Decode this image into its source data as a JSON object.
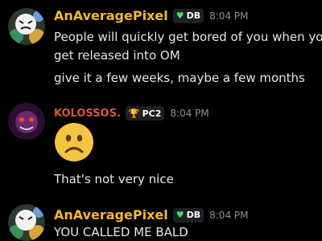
{
  "messages": [
    {
      "author": "AnAveragePixel",
      "author_color": "#f7b731",
      "badge": {
        "icon": "heart-icon",
        "text": "DB",
        "icon_color": "#3ee56a"
      },
      "time": "8:04 PM",
      "lines": [
        "People will quickly get bored of you when you",
        "get released into OM",
        "give it a few weeks, maybe a few months"
      ]
    },
    {
      "author": "KOLOSSOS.",
      "author_color": "#d45a3a",
      "badge": {
        "icon": "trophy-icon",
        "text": "PC2",
        "icon_color": "#f0c23b"
      },
      "time": "8:04 PM",
      "emoji": "frowning-face-emoji",
      "lines": [
        "That's not very nice"
      ]
    },
    {
      "author": "AnAveragePixel",
      "author_color": "#f7b731",
      "badge": {
        "icon": "heart-icon",
        "text": "DB",
        "icon_color": "#3ee56a"
      },
      "time": "8:04 PM",
      "lines": [
        "YOU CALLED ME BALD"
      ]
    }
  ]
}
